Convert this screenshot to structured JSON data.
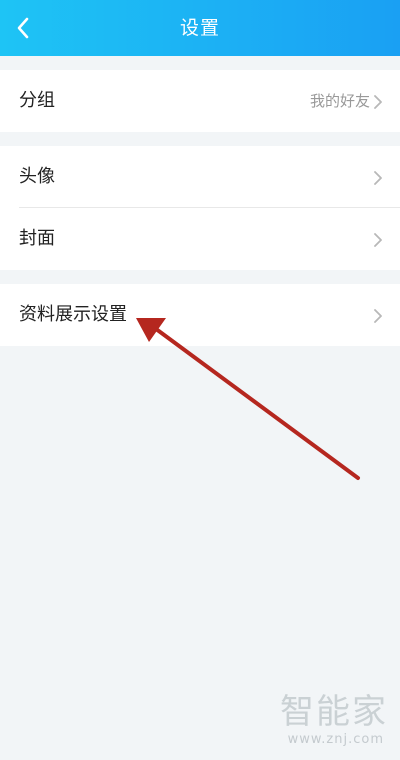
{
  "header": {
    "title": "设置",
    "back_icon": "back-chevron-icon",
    "gradient_colors": [
      "#1ec4f5",
      "#1aa0f3"
    ]
  },
  "groups": [
    {
      "items": [
        {
          "label": "分组",
          "value": "我的好友"
        }
      ]
    },
    {
      "items": [
        {
          "label": "头像"
        },
        {
          "label": "封面"
        }
      ]
    },
    {
      "items": [
        {
          "label": "资料展示设置"
        }
      ]
    }
  ],
  "annotation": {
    "type": "arrow",
    "color": "#b5271f",
    "points_to": "资料展示设置"
  },
  "watermark": {
    "logo_text": "智能家",
    "url": "www.znj.com"
  }
}
